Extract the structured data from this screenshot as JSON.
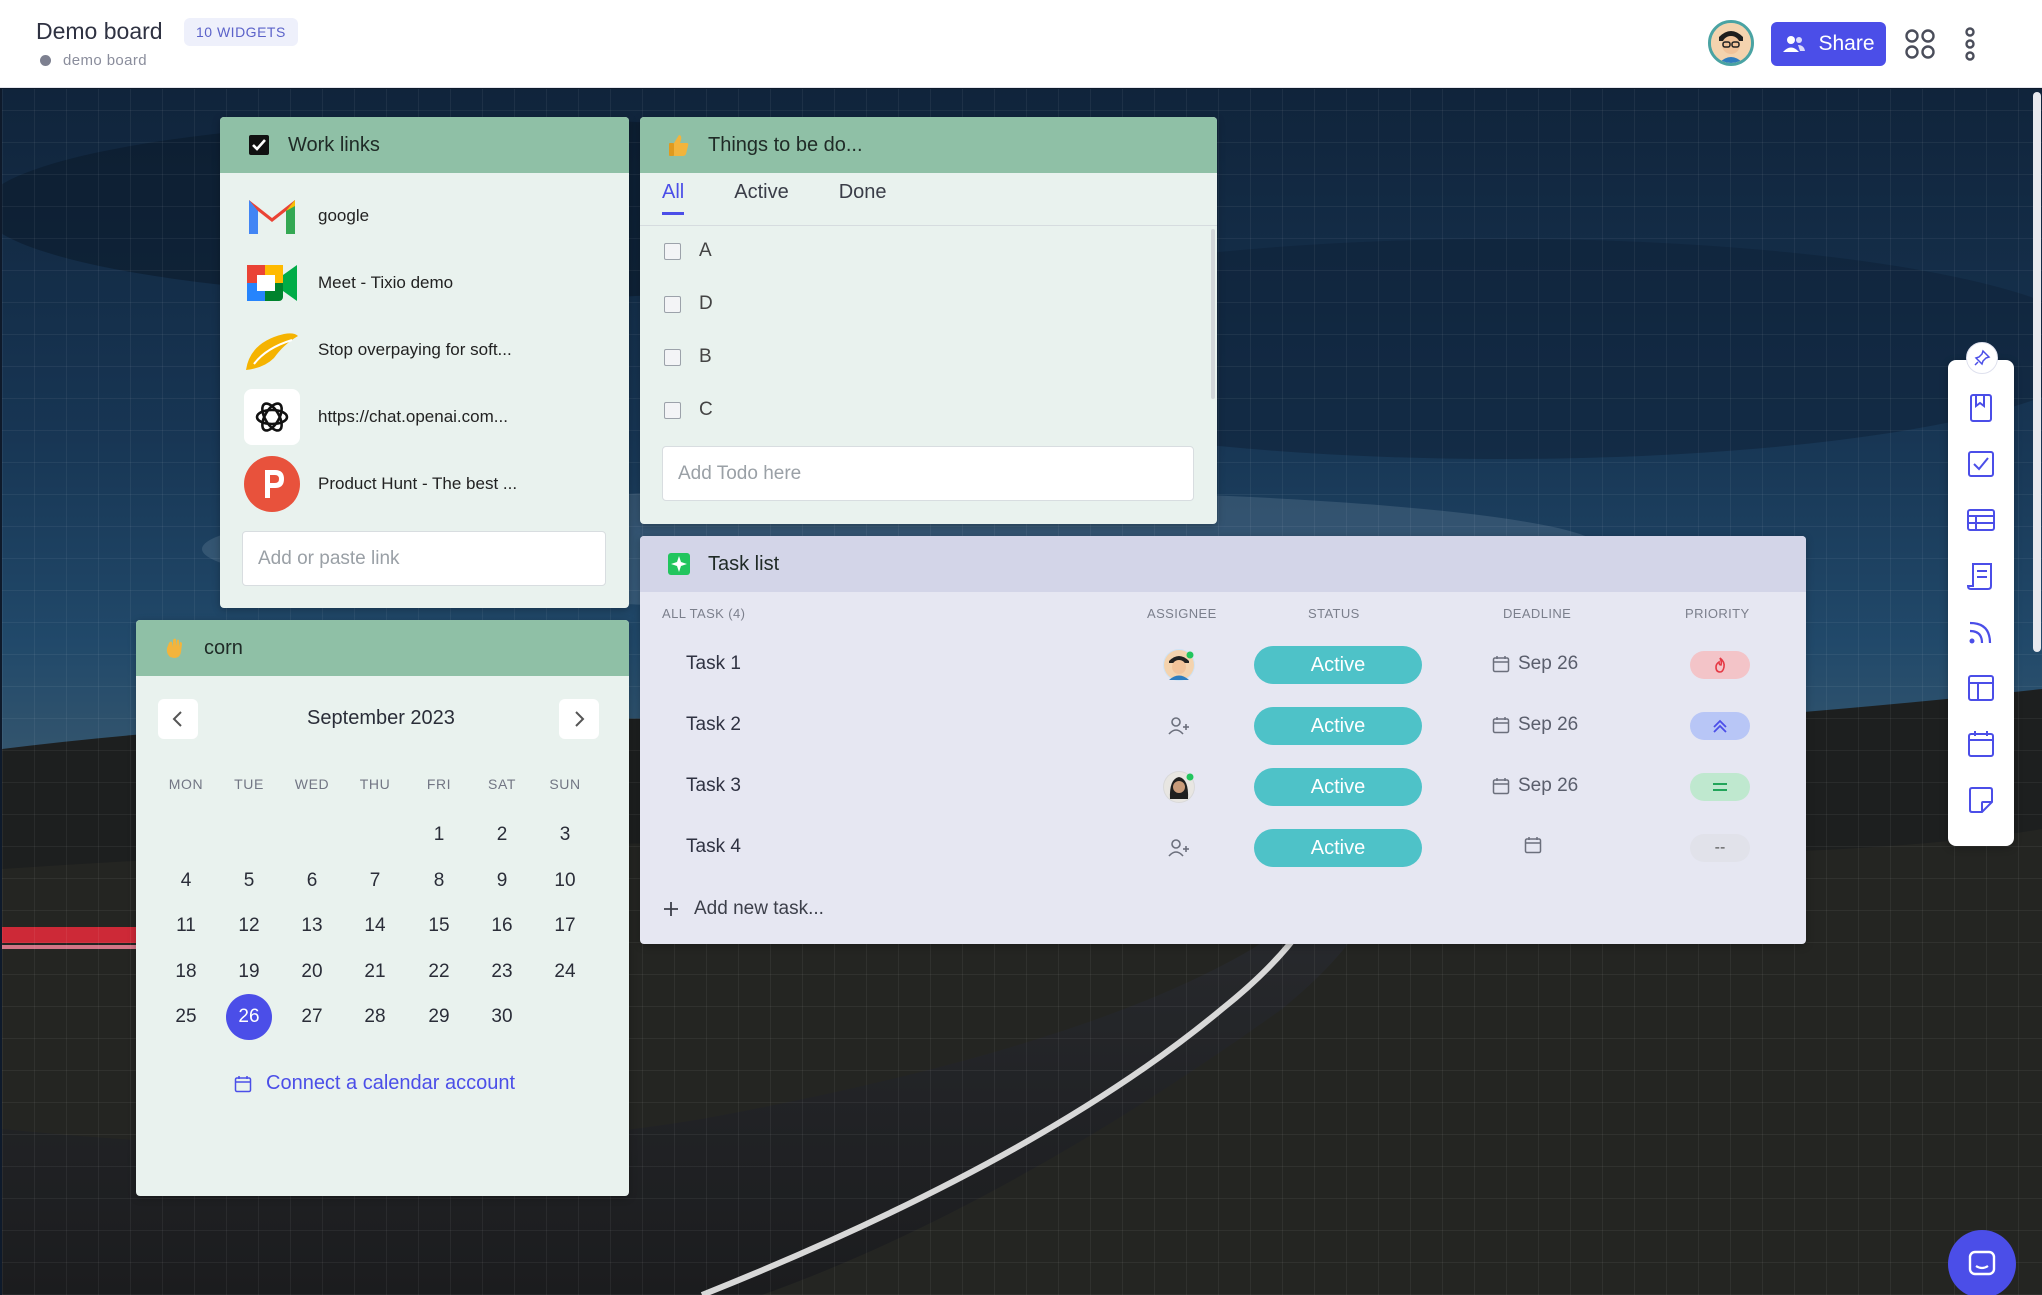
{
  "header": {
    "title": "Demo board",
    "widget_count": "10 WIDGETS",
    "subtitle": "demo board",
    "share_label": "Share",
    "accent_color": "#4b4ee8"
  },
  "work_links": {
    "title": "Work links",
    "items": [
      {
        "label": "google",
        "icon": "gmail-icon"
      },
      {
        "label": "Meet - Tixio demo",
        "icon": "google-meet-icon"
      },
      {
        "label": "Stop overpaying for soft...",
        "icon": "link-logo-icon"
      },
      {
        "label": "https://chat.openai.com...",
        "icon": "openai-icon"
      },
      {
        "label": "Product Hunt - The best ...",
        "icon": "product-hunt-icon"
      }
    ],
    "input_placeholder": "Add or paste link"
  },
  "todo": {
    "title": "Things to be do...",
    "tabs": [
      "All",
      "Active",
      "Done"
    ],
    "active_tab": "All",
    "items": [
      "A",
      "D",
      "B",
      "C"
    ],
    "input_placeholder": "Add Todo here"
  },
  "task_list": {
    "title": "Task list",
    "columns": {
      "task": "ALL TASK (4)",
      "assignee": "ASSIGNEE",
      "status": "STATUS",
      "deadline": "DEADLINE",
      "priority": "PRIORITY"
    },
    "tasks": [
      {
        "name": "Task 1",
        "assignee": "avatar",
        "status": "Active",
        "deadline": "Sep 26",
        "priority": "urgent"
      },
      {
        "name": "Task 2",
        "assignee": "add",
        "status": "Active",
        "deadline": "Sep 26",
        "priority": "high"
      },
      {
        "name": "Task 3",
        "assignee": "avatar",
        "status": "Active",
        "deadline": "Sep 26",
        "priority": "medium"
      },
      {
        "name": "Task 4",
        "assignee": "add",
        "status": "Active",
        "deadline": "",
        "priority": "--"
      }
    ],
    "add_label": "Add new task..."
  },
  "calendar": {
    "title": "corn",
    "month": "September 2023",
    "weekdays": [
      "MON",
      "TUE",
      "WED",
      "THU",
      "FRI",
      "SAT",
      "SUN"
    ],
    "first_weekday_index": 4,
    "days_in_month": 30,
    "today": 26,
    "connect_label": "Connect a calendar account"
  }
}
